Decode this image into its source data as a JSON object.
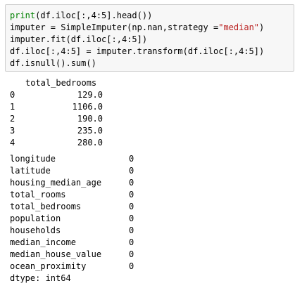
{
  "code_cell": {
    "lines": [
      {
        "print_kw": "print",
        "rest": "(df.iloc[:,4:5].head())"
      },
      {
        "before": "imputer = SimpleImputer(np.nan,strategy =",
        "string": "\"median\"",
        "after": ")"
      },
      {
        "text": "imputer.fit(df.iloc[:,4:5])"
      },
      {
        "text": "df.iloc[:,4:5] = imputer.transform(df.iloc[:,4:5])"
      },
      {
        "text": "df.isnull().sum()"
      }
    ]
  },
  "head_output": {
    "column_header": "total_bedrooms",
    "rows": [
      {
        "index": "0",
        "value": "129.0"
      },
      {
        "index": "1",
        "value": "1106.0"
      },
      {
        "index": "2",
        "value": "190.0"
      },
      {
        "index": "3",
        "value": "235.0"
      },
      {
        "index": "4",
        "value": "280.0"
      }
    ]
  },
  "isnull_output": {
    "rows": [
      {
        "column": "longitude",
        "count": "0"
      },
      {
        "column": "latitude",
        "count": "0"
      },
      {
        "column": "housing_median_age",
        "count": "0"
      },
      {
        "column": "total_rooms",
        "count": "0"
      },
      {
        "column": "total_bedrooms",
        "count": "0"
      },
      {
        "column": "population",
        "count": "0"
      },
      {
        "column": "households",
        "count": "0"
      },
      {
        "column": "median_income",
        "count": "0"
      },
      {
        "column": "median_house_value",
        "count": "0"
      },
      {
        "column": "ocean_proximity",
        "count": "0"
      }
    ],
    "dtype_line": "dtype: int64"
  }
}
